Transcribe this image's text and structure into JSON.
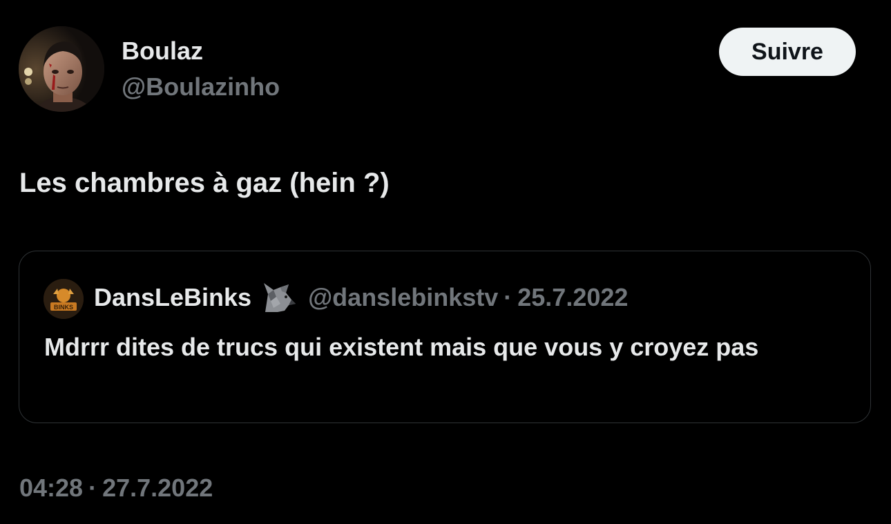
{
  "tweet": {
    "author": {
      "display_name": "Boulaz",
      "handle": "@Boulazinho"
    },
    "follow_label": "Suivre",
    "text": "Les chambres à gaz (hein ?)",
    "time": "04:28",
    "date": "27.7.2022",
    "separator": "·"
  },
  "quote": {
    "display_name": "DansLeBinks",
    "badge_icon": "wolf-emoji-icon",
    "handle": "@danslebinkstv",
    "separator": "·",
    "date": "25.7.2022",
    "text": "Mdrrr dites de trucs qui existent mais que vous y croyez pas",
    "avatar_logo_text": "BINKS"
  },
  "colors": {
    "background": "#000000",
    "primary_text": "#e7e9ea",
    "secondary_text": "#71767b",
    "border": "#2f3336",
    "button_bg": "#eff3f4",
    "button_text": "#0f1419"
  }
}
